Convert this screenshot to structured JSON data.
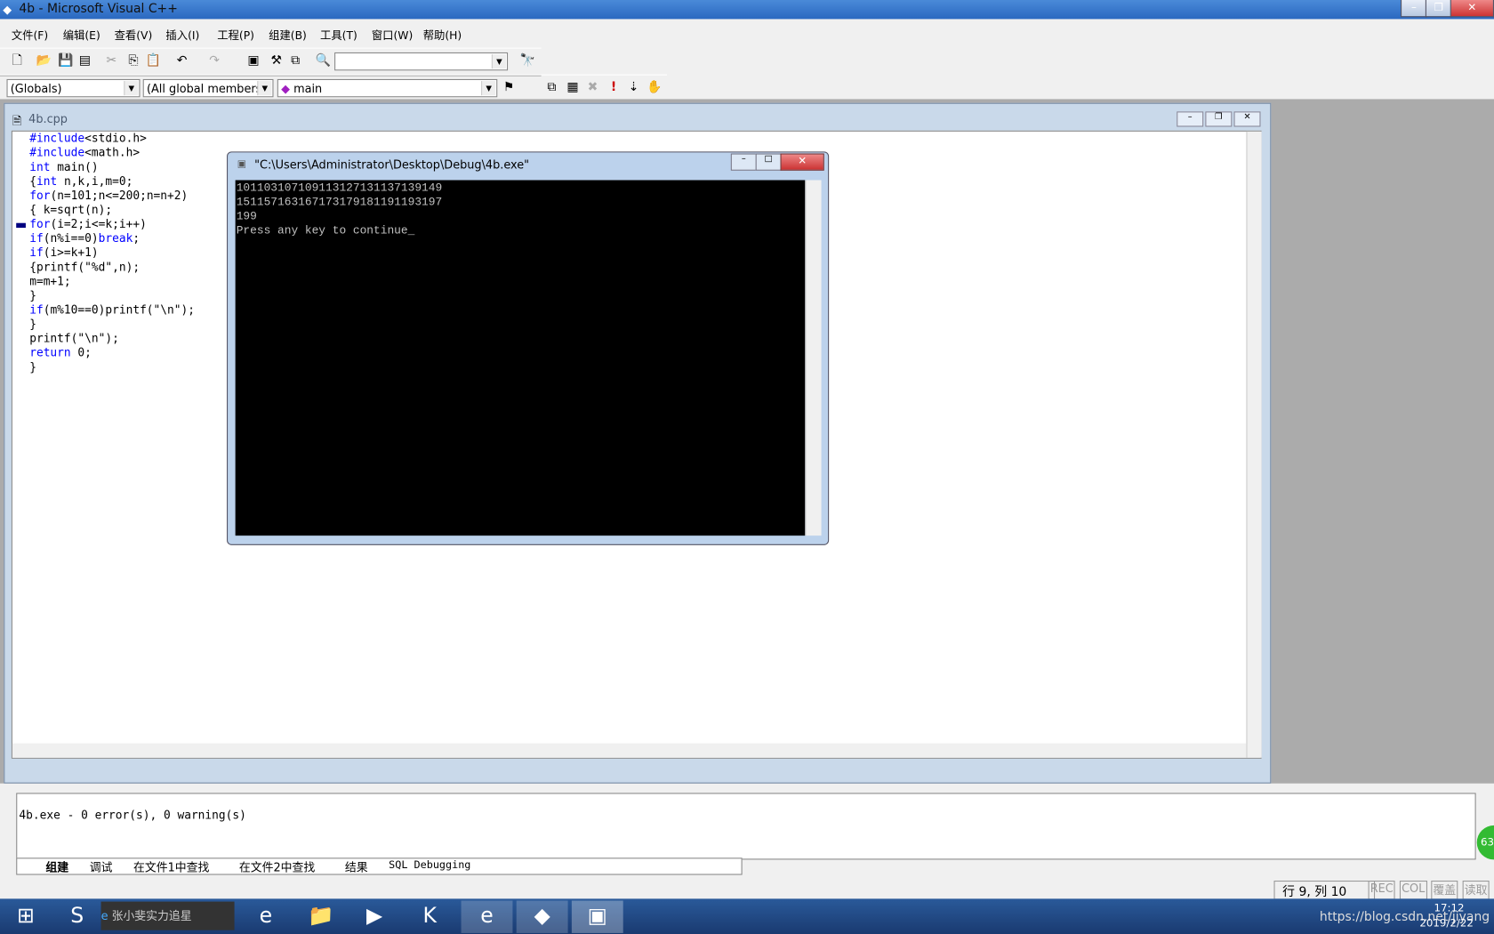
{
  "window": {
    "title": "4b - Microsoft Visual C++",
    "controls": [
      "–",
      "❐",
      "✕"
    ]
  },
  "menu": [
    "文件(F)",
    "编辑(E)",
    "查看(V)",
    "插入(I)",
    "工程(P)",
    "组建(B)",
    "工具(T)",
    "窗口(W)",
    "帮助(H)"
  ],
  "toolbar": {
    "find_value": "",
    "globals": "(Globals)",
    "members": "(All global members",
    "function": "main"
  },
  "document": {
    "title": "4b.cpp"
  },
  "code": [
    [
      [
        "#include",
        "k"
      ],
      [
        "<stdio.h>",
        ""
      ]
    ],
    [
      [
        "#include",
        "k"
      ],
      [
        "<math.h>",
        ""
      ]
    ],
    [
      [
        "int",
        "k"
      ],
      [
        " main()",
        ""
      ]
    ],
    [
      [
        "{",
        ""
      ],
      [
        "int",
        "k"
      ],
      [
        " n,k,i,m=0;",
        ""
      ]
    ],
    [
      [
        "for",
        "k"
      ],
      [
        "(n=101;n<=200;n=n+2)",
        ""
      ]
    ],
    [
      [
        "{ k=sqrt(n);",
        ""
      ]
    ],
    [
      [
        "for",
        "k"
      ],
      [
        "(i=2;i<=k;i++)",
        ""
      ]
    ],
    [
      [
        "if",
        "k"
      ],
      [
        "(n%i==0)",
        ""
      ],
      [
        "break",
        "k"
      ],
      [
        ";",
        ""
      ]
    ],
    [
      [
        "if",
        "k"
      ],
      [
        "(i>=k+1)",
        ""
      ]
    ],
    [
      [
        "{printf(\"%d\",n);",
        ""
      ]
    ],
    [
      [
        "m=m+1;",
        ""
      ]
    ],
    [
      [
        "}",
        ""
      ]
    ],
    [
      [
        "if",
        "k"
      ],
      [
        "(m%10==0)printf(\"\\n\");",
        ""
      ]
    ],
    [
      [
        "}",
        ""
      ]
    ],
    [
      [
        "printf(\"\\n\");",
        ""
      ]
    ],
    [
      [
        "return",
        "k"
      ],
      [
        " 0;",
        ""
      ]
    ],
    [
      [
        "}",
        ""
      ]
    ]
  ],
  "console": {
    "title": "\"C:\\Users\\Administrator\\Desktop\\Debug\\4b.exe\"",
    "lines": [
      "101103107109113127131137139149",
      "151157163167173179181191193197",
      "199",
      "Press any key to continue_"
    ]
  },
  "output": {
    "text": "4b.exe - 0 error(s), 0 warning(s)",
    "tabs": [
      "组建",
      "调试",
      "在文件1中查找",
      "在文件2中查找",
      "结果",
      "SQL Debugging"
    ]
  },
  "status": {
    "position": "行 9, 列 10",
    "indicators": [
      "REC",
      "COL",
      "覆盖",
      "读取"
    ]
  },
  "taskbar": {
    "search_text": "张小斐实力追星",
    "clock_time": "17:12",
    "clock_date": "2019/2/22",
    "watermark": "https://blog.csdn.net/jiyang",
    "badge": "63"
  }
}
